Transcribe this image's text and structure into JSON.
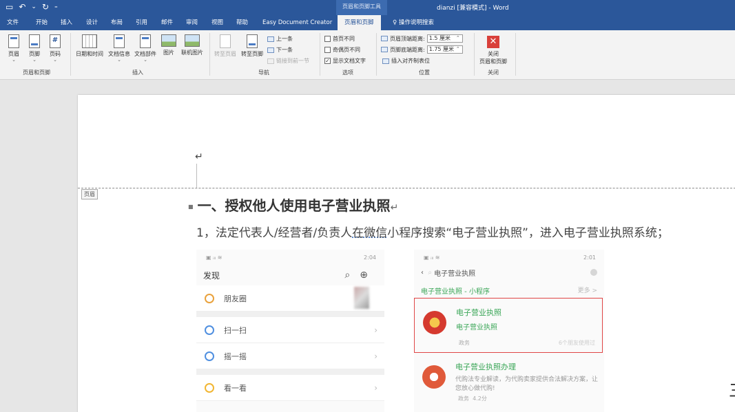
{
  "titlebar": {
    "context_tab": "页眉和页脚工具",
    "document_title": "dianzi  [兼容模式]  -  Word"
  },
  "menu_tabs": [
    {
      "label": "文件"
    },
    {
      "label": "开始"
    },
    {
      "label": "插入"
    },
    {
      "label": "设计"
    },
    {
      "label": "布局"
    },
    {
      "label": "引用"
    },
    {
      "label": "邮件"
    },
    {
      "label": "审阅"
    },
    {
      "label": "视图"
    },
    {
      "label": "帮助"
    },
    {
      "label": "Easy Document Creator"
    },
    {
      "label": "页眉和页脚"
    },
    {
      "label": "操作说明搜索"
    }
  ],
  "ribbon": {
    "header_footer": {
      "header": "页眉",
      "footer": "页脚",
      "page_number": "页码",
      "group": "页眉和页脚"
    },
    "insert": {
      "datetime": "日期和时间",
      "docinfo": "文档信息",
      "quickparts": "文档部件",
      "picture": "图片",
      "online_picture": "联机图片",
      "group": "插入"
    },
    "navigation": {
      "goto_header": "转至页眉",
      "goto_footer": "转至页脚",
      "previous": "上一条",
      "next": "下一条",
      "link_previous": "链接到前一节",
      "group": "导航"
    },
    "options": {
      "diff_first": "首页不同",
      "diff_odd_even": "奇偶页不同",
      "show_doc_text": "显示文档文字",
      "group": "选项"
    },
    "position": {
      "header_from_top_label": "页眉顶端距离:",
      "header_from_top_value": "1.5 厘米",
      "footer_from_bottom_label": "页脚底端距离:",
      "footer_from_bottom_value": "1.75 厘米",
      "insert_align_tab": "插入对齐制表位",
      "group": "位置"
    },
    "close": {
      "label_1": "关闭",
      "label_2": "页眉和页脚",
      "group": "关闭"
    }
  },
  "document": {
    "header_tag": "页眉",
    "heading": "一、授权他人使用电子营业执照",
    "paragraph_a": "1，法定代表人/经营者/负责人",
    "paragraph_b": "在微信",
    "paragraph_c": "小程序搜索“电子营业执照”，进入电子营业执照系统；"
  },
  "shot1": {
    "status_right": "2:04",
    "title": "发现",
    "rows": [
      {
        "label": "朋友圈",
        "color": "#e9a13b"
      },
      {
        "label": "扫一扫",
        "color": "#4f8fe0"
      },
      {
        "label": "摇一摇",
        "color": "#4f8fe0"
      },
      {
        "label": "看一看",
        "color": "#f2b632"
      }
    ]
  },
  "shot2": {
    "status_right": "2:01",
    "search_text": "电子营业执照",
    "category": "电子营业执照 - 小程序",
    "more": "更多 >",
    "result1": {
      "title": "电子营业执照",
      "subtitle": "电子营业执照",
      "tag": "政务",
      "friends": "6个朋友使用过"
    },
    "result2": {
      "title": "电子营业执照办理",
      "desc": "代购法专业解读，为代购卖家提供合法解决方案，让您放心做代购!",
      "tag": "政务",
      "rating": "4.2分"
    }
  }
}
